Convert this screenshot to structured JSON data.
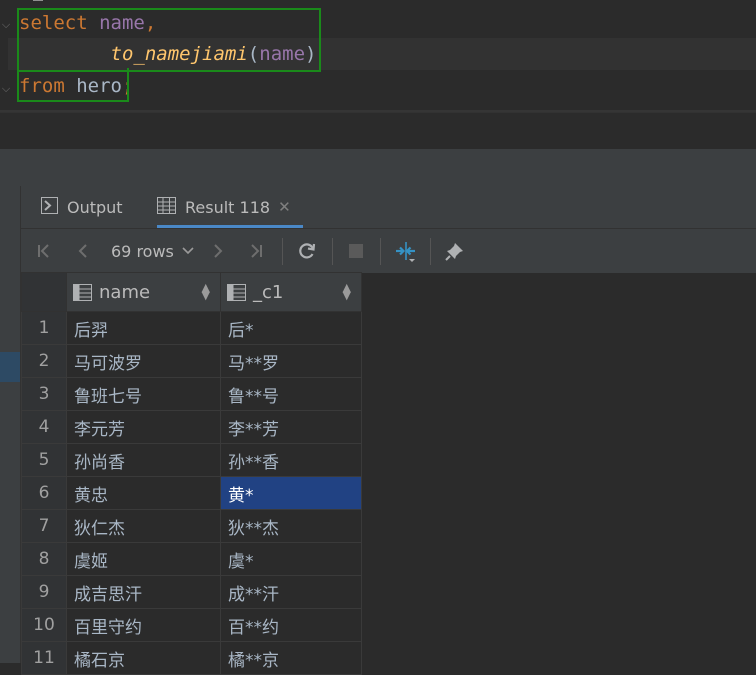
{
  "editor": {
    "tokens": {
      "select_kw": "select",
      "name_col": "name",
      "comma": ",",
      "fn_name": "to_namejiami",
      "lparen": "(",
      "arg": "name",
      "rparen": ")",
      "from_kw": "from",
      "table": "hero",
      "semicolon": ";"
    }
  },
  "panel": {
    "tabs": [
      {
        "label": "Output",
        "icon": "console-icon"
      },
      {
        "label": "Result 118",
        "icon": "table-icon",
        "close": "✕"
      }
    ],
    "toolbar": {
      "rows_label": "69 rows",
      "chevron": "⌄"
    }
  },
  "result": {
    "columns": [
      {
        "label": "name"
      },
      {
        "label": "_c1"
      }
    ],
    "rows": [
      {
        "n": "1",
        "name": "后羿",
        "c1": "后*"
      },
      {
        "n": "2",
        "name": "马可波罗",
        "c1": "马**罗"
      },
      {
        "n": "3",
        "name": "鲁班七号",
        "c1": "鲁**号"
      },
      {
        "n": "4",
        "name": "李元芳",
        "c1": "李**芳"
      },
      {
        "n": "5",
        "name": "孙尚香",
        "c1": "孙**香"
      },
      {
        "n": "6",
        "name": "黄忠",
        "c1": "黄*"
      },
      {
        "n": "7",
        "name": "狄仁杰",
        "c1": "狄**杰"
      },
      {
        "n": "8",
        "name": "虞姬",
        "c1": "虞*"
      },
      {
        "n": "9",
        "name": "成吉思汗",
        "c1": "成**汗"
      },
      {
        "n": "10",
        "name": "百里守约",
        "c1": "百**约"
      },
      {
        "n": "11",
        "name": "橘石京",
        "c1": "橘**京"
      }
    ],
    "selected_row": 6
  },
  "colors": {
    "keyword": "#cc7832",
    "column": "#9876aa",
    "function": "#ffc66d",
    "selection": "#214283",
    "highlight_box": "#1a8a1a"
  }
}
